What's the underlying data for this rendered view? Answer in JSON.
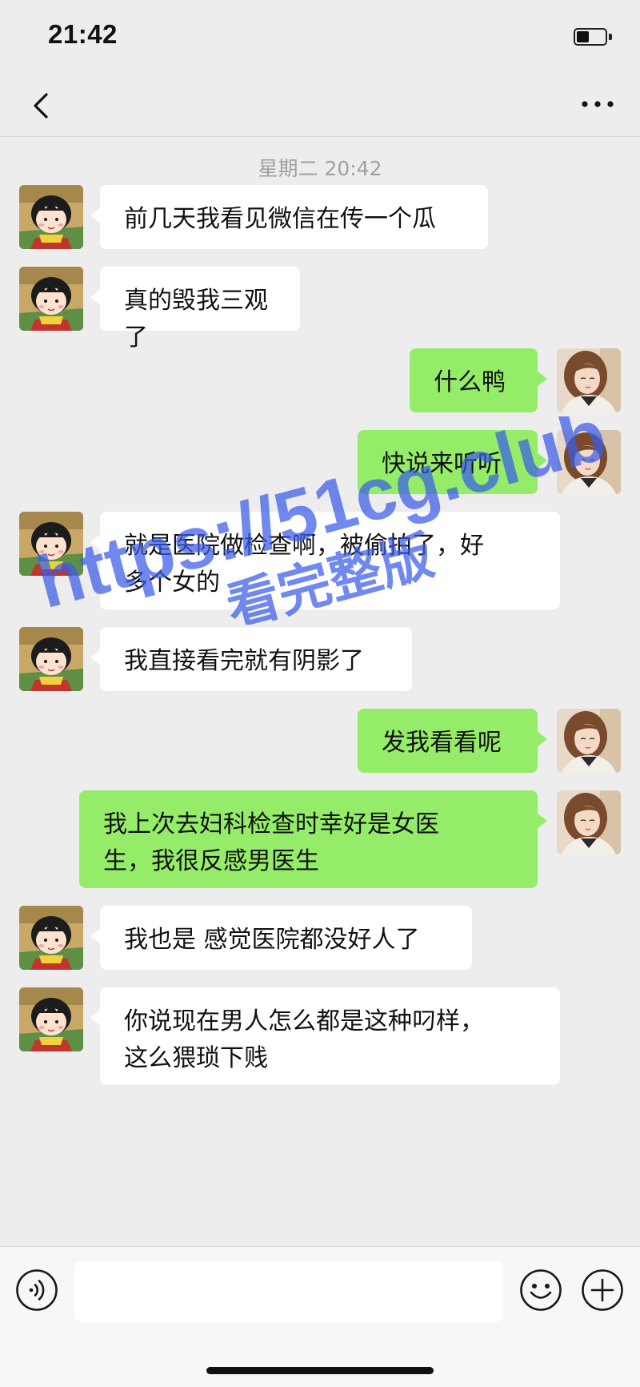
{
  "status_bar": {
    "time": "21:42",
    "battery_level": 0.45
  },
  "nav": {
    "back_icon": "chevron-left-icon",
    "more_icon": "more-horizontal-icon"
  },
  "chat": {
    "timestamp": "星期二 20:42",
    "messages": [
      {
        "side": "left",
        "avatar": "cartoon-girl-avatar",
        "text": "前几天我看见微信在传一个瓜"
      },
      {
        "side": "left",
        "avatar": "cartoon-girl-avatar",
        "text": "真的毁我三观了"
      },
      {
        "side": "right",
        "avatar": "user-photo-avatar",
        "text": "什么鸭"
      },
      {
        "side": "right",
        "avatar": "user-photo-avatar",
        "text": "快说来听听"
      },
      {
        "side": "left",
        "avatar": "cartoon-girl-avatar",
        "text": "就是医院做检查啊，被偷拍了，好\n多个女的"
      },
      {
        "side": "left",
        "avatar": "cartoon-girl-avatar",
        "text": "我直接看完就有阴影了"
      },
      {
        "side": "right",
        "avatar": "user-photo-avatar",
        "text": "发我看看呢"
      },
      {
        "side": "right",
        "avatar": "user-photo-avatar",
        "text": "我上次去妇科检查时幸好是女医\n生，我很反感男医生"
      },
      {
        "side": "left",
        "avatar": "cartoon-girl-avatar",
        "text": "我也是 感觉医院都没好人了"
      },
      {
        "side": "left",
        "avatar": "cartoon-girl-avatar",
        "text": "你说现在男人怎么都是这种叼样，\n这么猥琐下贱"
      }
    ]
  },
  "watermark": {
    "line1": "https://51cg.club",
    "line2": "看完整版"
  },
  "input_bar": {
    "voice_icon": "voice-icon",
    "input_value": "",
    "emoji_icon": "emoji-icon",
    "plus_icon": "plus-circle-icon"
  },
  "colors": {
    "background": "#ededed",
    "bubble_left": "#ffffff",
    "bubble_right": "#95ec69",
    "timestamp": "#a0a0a0",
    "watermark": "#3a5ce8"
  }
}
